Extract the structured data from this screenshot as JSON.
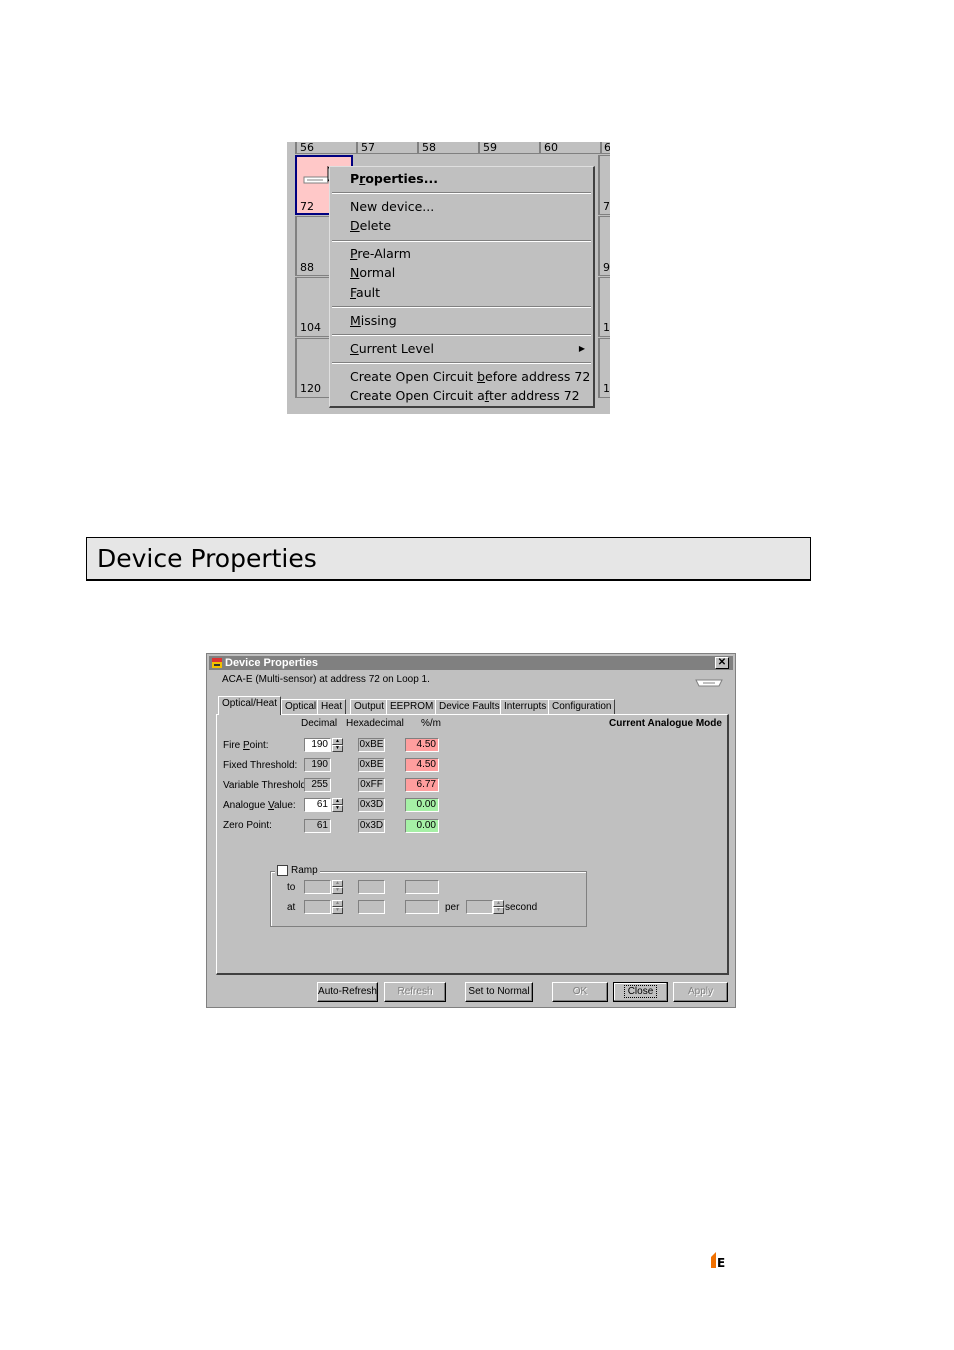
{
  "grid": {
    "header_numbers": [
      "56",
      "57",
      "58",
      "59",
      "60",
      "6"
    ],
    "row_numbers": [
      "72",
      "88",
      "104",
      "120"
    ],
    "right_numbers": [
      "7",
      "9",
      "1",
      "1"
    ]
  },
  "context_menu": {
    "properties": "Properties...",
    "new_device": "New device...",
    "delete": "Delete",
    "pre_alarm": "Pre-Alarm",
    "normal": "Normal",
    "fault": "Fault",
    "missing": "Missing",
    "current_level": "Current Level",
    "open_before": "Create Open Circuit before address 72",
    "open_after": "Create Open Circuit after address 72"
  },
  "section": {
    "title": "Device Properties"
  },
  "dialog": {
    "title": "Device Properties",
    "close_glyph": "✕",
    "description": "ACA-E (Multi-sensor) at address 72 on Loop 1.",
    "tabs": [
      "Optical/Heat",
      "Optical",
      "Heat",
      "Output",
      "EEPROM",
      "Device Faults",
      "Interrupts",
      "Configuration"
    ],
    "active_tab": "Optical/Heat",
    "mode_label": "Current Analogue Mode",
    "columns": {
      "decimal": "Decimal",
      "hex": "Hexadecimal",
      "pct": "%/m"
    },
    "rows": [
      {
        "label": "Fire Point:",
        "decimal": "190",
        "hex": "0xBE",
        "pct": "4.50",
        "editable": true,
        "pct_color": "#ff9e9e"
      },
      {
        "label": "Fixed Threshold:",
        "decimal": "190",
        "hex": "0xBE",
        "pct": "4.50",
        "editable": false,
        "pct_color": "#ff9e9e"
      },
      {
        "label": "Variable Threshold:",
        "decimal": "255",
        "hex": "0xFF",
        "pct": "6.77",
        "editable": false,
        "pct_color": "#ff9e9e"
      },
      {
        "label": "Analogue Value:",
        "decimal": "61",
        "hex": "0x3D",
        "pct": "0.00",
        "editable": true,
        "pct_color": "#a6f0a6"
      },
      {
        "label": "Zero Point:",
        "decimal": "61",
        "hex": "0x3D",
        "pct": "0.00",
        "editable": false,
        "pct_color": "#a6f0a6"
      }
    ],
    "ramp": {
      "label": "Ramp",
      "to": "to",
      "at": "at",
      "per": "per",
      "second": "second",
      "checked": false
    },
    "buttons": {
      "auto_refresh": "Auto-Refresh",
      "refresh": "Refresh",
      "set_normal": "Set to Normal",
      "ok": "OK",
      "close": "Close",
      "apply": "Apply"
    }
  },
  "footer": {
    "logo_letter": "E"
  }
}
